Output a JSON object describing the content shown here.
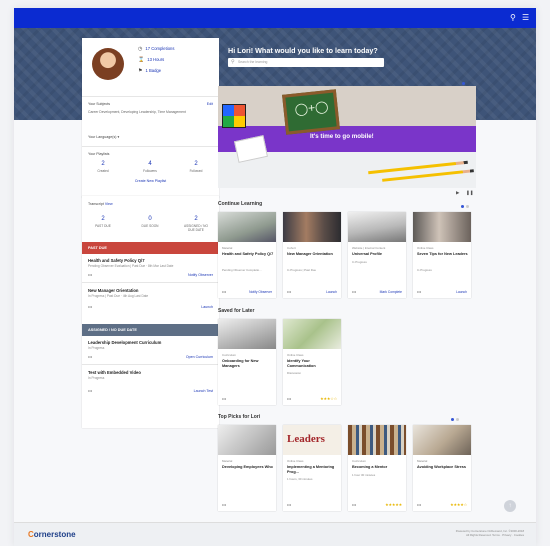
{
  "header": {
    "search_icon": "search-icon",
    "menu_icon": "hamburger-menu-icon"
  },
  "hero": {
    "greeting": "Hi Lori! What would you like to learn today?",
    "search_placeholder": "Search the learning"
  },
  "profile": {
    "completions": "17 Completions",
    "hours": "13 Hours",
    "badge": "1 Badge",
    "subjects_label": "Your Subjects",
    "subjects_edit": "Edit",
    "subjects_value": "Career Development, Developing Leadership, Time Management",
    "languages_label": "Your Language(s)",
    "playlists_label": "Your Playlists",
    "playlists": [
      {
        "count": "2",
        "label": "Created"
      },
      {
        "count": "4",
        "label": "Followers"
      },
      {
        "count": "2",
        "label": "Followed"
      }
    ],
    "create_playlist": "Create New Playlist"
  },
  "transcript": {
    "label": "Transcript",
    "view": "View",
    "stats": [
      {
        "count": "2",
        "label": "PAST DUE"
      },
      {
        "count": "0",
        "label": "DUE SOON"
      },
      {
        "count": "2",
        "label": "ASSIGNED / NO DUE DATE"
      }
    ],
    "past_due_header": "PAST DUE",
    "past_due": [
      {
        "title": "Health and Safety Policy Q/7",
        "sub": "Pending Observer Evaluation | Past Due · 8th Mar Last Date",
        "action": "Notify Observer"
      },
      {
        "title": "New Manager Orientation",
        "sub": "In Progress | Past Due · 4th Aug Last Date",
        "action": "Launch"
      }
    ],
    "assigned_header": "ASSIGNED / NO DUE DATE",
    "assigned": [
      {
        "title": "Leadership Development Curriculum",
        "sub": "In Progress",
        "action": "Open Curriculum"
      },
      {
        "title": "Test with Embedded Video",
        "sub": "In Progress",
        "action": "Launch Test"
      }
    ]
  },
  "banner": {
    "text": "It's time to go mobile!",
    "play_icon": "play-icon",
    "pause_icon": "pause-icon"
  },
  "continue_learning": {
    "title": "Continue Learning",
    "courses": [
      {
        "type": "Material",
        "title": "Health and Safety Policy Q/7",
        "sub": "Pending Observer Completio...",
        "action": "Notify Observer"
      },
      {
        "type": "Cohort",
        "title": "New Manager Orientation",
        "sub": "In Progress | Past Due",
        "action": "Launch"
      },
      {
        "type": "Website | Internal Content",
        "title": "Universal Profile",
        "sub": "In Progress",
        "action": "Mark Complete"
      },
      {
        "type": "Online Class",
        "title": "Seven Tips for New Leaders",
        "sub": "In Progress",
        "action": "Launch"
      }
    ]
  },
  "saved_for_later": {
    "title": "Saved for Later",
    "courses": [
      {
        "type": "Curriculum",
        "title": "Onboarding for New Managers",
        "sub": "",
        "stars": ""
      },
      {
        "type": "Online Class",
        "title": "Identify Your Communication",
        "sub": "Discussion",
        "stars": "★★★☆☆"
      }
    ]
  },
  "top_picks": {
    "title": "Top Picks for Lori",
    "courses": [
      {
        "type": "Material",
        "title": "Developing Employees Who",
        "sub": "",
        "stars": ""
      },
      {
        "type": "Online Class",
        "title": "Implementing a Mentoring Prog...",
        "sub": "1 hours, 30 minutes",
        "stars": ""
      },
      {
        "type": "Curriculum",
        "title": "Becoming a Mentor",
        "sub": "1 hour 30 minutes",
        "stars": "★★★★★"
      },
      {
        "type": "Material",
        "title": "Avoiding Workplace Stress",
        "sub": "",
        "stars": "★★★★☆"
      }
    ],
    "leaders_image_text": "Leaders"
  },
  "footer": {
    "logo_c": "C",
    "logo_rest": "ornerstone",
    "legal_1": "Powered by Cornerstone OnDemand, Inc. ©2000-2018",
    "legal_2": "All Rights Reserved.  Terms  ·  Privacy  ·  Cookies"
  }
}
